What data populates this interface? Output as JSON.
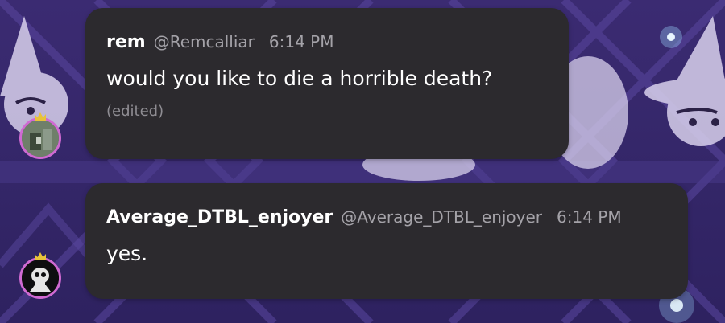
{
  "messages": [
    {
      "author": "rem",
      "handle": "@Remcalliar",
      "time": "6:14 PM",
      "text": "would you like to die a horrible death?",
      "edited_label": "(edited)",
      "avatar": "pixel-avatar"
    },
    {
      "author": "Average_DTBL_enjoyer",
      "handle": "@Average_DTBL_enjoyer",
      "time": "6:14 PM",
      "text": "yes.",
      "avatar": "skull-avatar"
    }
  ],
  "colors": {
    "background": "#3a2a6e",
    "bubble": "#2c2a2e",
    "muted_text": "#a4a2a8",
    "avatar_ring": "#d06ad2",
    "crown": "#e8c23a"
  }
}
